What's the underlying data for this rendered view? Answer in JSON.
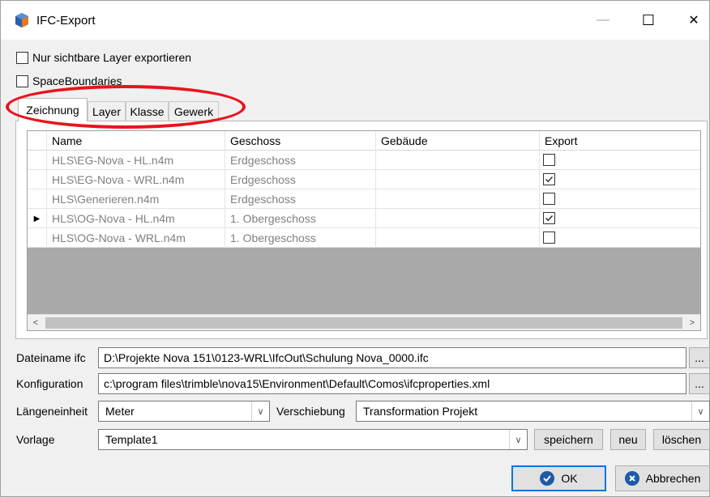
{
  "window": {
    "title": "IFC-Export",
    "min_glyph": "—",
    "max_glyph": "☐",
    "close_glyph": "✕"
  },
  "options": {
    "visible_layers_label": "Nur sichtbare Layer exportieren",
    "visible_layers_checked": false,
    "space_boundaries_label": "SpaceBoundaries",
    "space_boundaries_checked": false
  },
  "tabs": [
    {
      "label": "Zeichnung",
      "active": true
    },
    {
      "label": "Layer",
      "active": false
    },
    {
      "label": "Klasse",
      "active": false
    },
    {
      "label": "Gewerk",
      "active": false
    }
  ],
  "grid": {
    "columns": [
      "Name",
      "Geschoss",
      "Gebäude",
      "Export"
    ],
    "rows": [
      {
        "name": "HLS\\EG-Nova - HL.n4m",
        "geschoss": "Erdgeschoss",
        "gebaeude": "",
        "export": false,
        "current": false
      },
      {
        "name": "HLS\\EG-Nova - WRL.n4m",
        "geschoss": "Erdgeschoss",
        "gebaeude": "",
        "export": true,
        "current": false
      },
      {
        "name": "HLS\\Generieren.n4m",
        "geschoss": "Erdgeschoss",
        "gebaeude": "",
        "export": false,
        "current": false
      },
      {
        "name": "HLS\\OG-Nova - HL.n4m",
        "geschoss": "1. Obergeschoss",
        "gebaeude": "",
        "export": true,
        "current": true
      },
      {
        "name": "HLS\\OG-Nova - WRL.n4m",
        "geschoss": "1. Obergeschoss",
        "gebaeude": "",
        "export": false,
        "current": false
      }
    ],
    "current_row_glyph": "▶",
    "scroll_left_glyph": "<",
    "scroll_right_glyph": ">"
  },
  "form": {
    "filename_label": "Dateiname ifc",
    "filename_value": "D:\\Projekte Nova 151\\0123-WRL\\IfcOut\\Schulung Nova_0000.ifc",
    "config_label": "Konfiguration",
    "config_value": "c:\\program files\\trimble\\nova15\\Environment\\Default\\Comos\\ifcproperties.xml",
    "browse_label": "...",
    "unit_label": "Längeneinheit",
    "unit_value": "Meter",
    "shift_label": "Verschiebung",
    "shift_value": "Transformation Projekt",
    "template_label": "Vorlage",
    "template_value": "Template1",
    "dropdown_glyph": "∨"
  },
  "buttons": {
    "save": "speichern",
    "new": "neu",
    "delete": "löschen",
    "ok": "OK",
    "cancel": "Abbrechen"
  },
  "colors": {
    "accent": "#0078d7",
    "highlight": "#e8141b",
    "ok_icon": "#1e5aa8",
    "cancel_icon": "#1e5aa8",
    "grid_empty": "#a9a9a9"
  }
}
